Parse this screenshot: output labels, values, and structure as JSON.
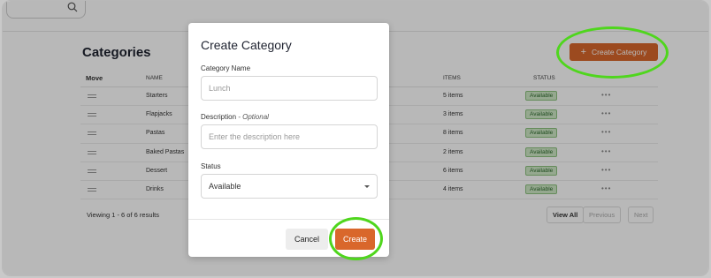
{
  "page": {
    "title": "Categories",
    "create_button_label": "Create Category",
    "table": {
      "headers": {
        "move": "Move",
        "name": "NAME",
        "items": "ITEMS",
        "status": "STATUS"
      },
      "rows": [
        {
          "name": "Starters",
          "items": "5 items",
          "status": "Available"
        },
        {
          "name": "Flapjacks",
          "items": "3 items",
          "status": "Available"
        },
        {
          "name": "Pastas",
          "items": "8 items",
          "status": "Available"
        },
        {
          "name": "Baked Pastas",
          "items": "2 items",
          "status": "Available"
        },
        {
          "name": "Dessert",
          "items": "6 items",
          "status": "Available"
        },
        {
          "name": "Drinks",
          "items": "4 items",
          "status": "Available"
        }
      ],
      "row_menu_glyph": "•••"
    },
    "results_text": "Viewing 1 - 6 of 6 results",
    "pagination": {
      "view_all": "View All",
      "previous": "Previous",
      "next": "Next"
    }
  },
  "modal": {
    "title": "Create Category",
    "name_label": "Category Name",
    "name_placeholder": "Lunch",
    "description_label": "Description",
    "description_optional": " - Optional",
    "description_placeholder": "Enter the description here",
    "status_label": "Status",
    "status_value": "Available",
    "cancel_label": "Cancel",
    "create_label": "Create"
  },
  "colors": {
    "accent": "#d9672b",
    "highlight": "#4fd61d",
    "badge_bg": "#cfe9c7",
    "badge_text": "#2c6a2c"
  },
  "icons": {
    "search": "search-icon",
    "plus": "plus-icon",
    "drag": "drag-handle-icon",
    "menu": "more-icon",
    "caret": "chevron-down-icon"
  }
}
